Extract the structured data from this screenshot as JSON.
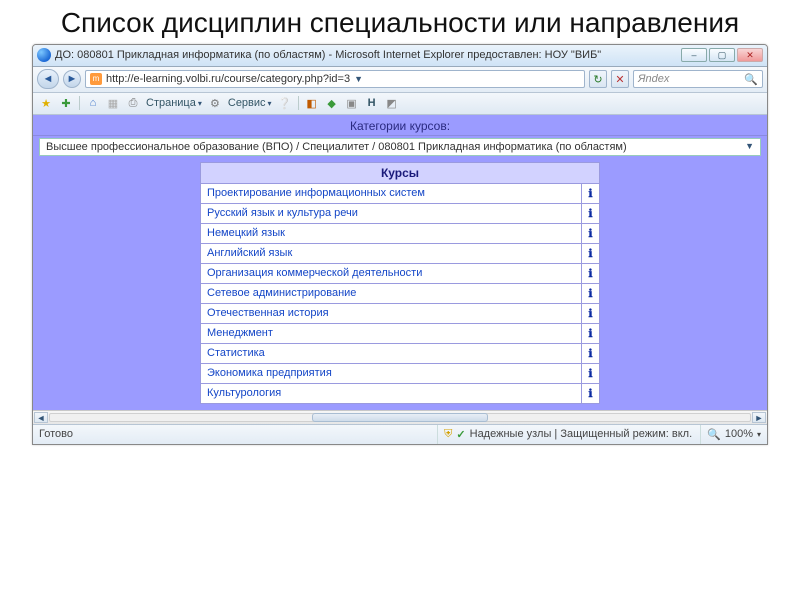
{
  "slide": {
    "title": "Список дисциплин специальности или направления"
  },
  "titlebar": {
    "text": "ДО: 080801 Прикладная информатика (по областям) - Microsoft Internet Explorer предоставлен: НОУ \"ВИБ\""
  },
  "address": {
    "url": "http://e-learning.volbi.ru/course/category.php?id=3",
    "search_placeholder": "Яndex"
  },
  "toolbar": {
    "page_label": "Страница",
    "service_label": "Сервис"
  },
  "category": {
    "heading": "Категории курсов:",
    "breadcrumb": "Высшее профессиональное образование (ВПО) / Специалитет / 080801 Прикладная информатика (по областям)"
  },
  "courses": {
    "header": "Курсы",
    "items": [
      {
        "name": "Проектирование информационных систем"
      },
      {
        "name": "Русский язык и культура речи"
      },
      {
        "name": "Немецкий язык"
      },
      {
        "name": "Английский язык"
      },
      {
        "name": "Организация коммерческой деятельности"
      },
      {
        "name": "Сетевое администрирование"
      },
      {
        "name": "Отечественная история"
      },
      {
        "name": "Менеджмент"
      },
      {
        "name": "Статистика"
      },
      {
        "name": "Экономика предприятия"
      },
      {
        "name": "Культурология"
      }
    ]
  },
  "status": {
    "ready": "Готово",
    "trusted": "Надежные узлы | Защищенный режим: вкл.",
    "zoom": "100%"
  }
}
